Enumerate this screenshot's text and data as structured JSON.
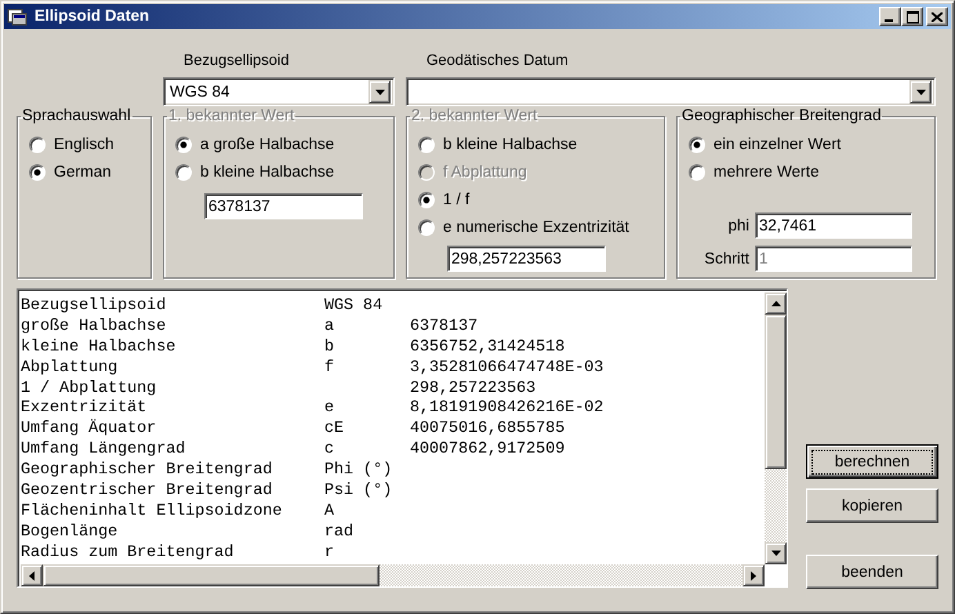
{
  "window": {
    "title": "Ellipsoid Daten"
  },
  "selectors": [
    {
      "label": "Bezugsellipsoid",
      "value": "WGS 84"
    },
    {
      "label": "Geodätisches Datum"
    }
  ],
  "groups": [
    {
      "title": "Sprachauswahl",
      "disabled": false,
      "options": [
        {
          "label": "Englisch",
          "selected": false,
          "disabled": false
        },
        {
          "label": "German",
          "selected": true,
          "disabled": false
        }
      ]
    },
    {
      "title": "1. bekannter Wert",
      "disabled": true,
      "options": [
        {
          "label": "a große Halbachse",
          "selected": true,
          "disabled": false
        },
        {
          "label": "b kleine Halbachse",
          "selected": false,
          "disabled": false
        }
      ],
      "fields": [
        {
          "value": "6378137",
          "disabled": false
        }
      ]
    },
    {
      "title": "2. bekannter Wert",
      "disabled": true,
      "options": [
        {
          "label": "b kleine Halbachse",
          "selected": false,
          "disabled": false
        },
        {
          "label": "f Abplattung",
          "selected": false,
          "disabled": true
        },
        {
          "label": "1 / f",
          "selected": true,
          "disabled": false
        },
        {
          "label": "e numerische Exzentrizität",
          "selected": false,
          "disabled": false
        }
      ],
      "fields": [
        {
          "value": "298,257223563",
          "disabled": false
        }
      ]
    },
    {
      "title": "Geographischer Breitengrad",
      "disabled": false,
      "options": [
        {
          "label": "ein einzelner Wert",
          "selected": true,
          "disabled": false
        },
        {
          "label": "mehrere Werte",
          "selected": false,
          "disabled": false
        }
      ],
      "fields": [
        {
          "label": "phi",
          "value": "32,7461",
          "disabled": false
        },
        {
          "label": "Schritt",
          "value": "1",
          "disabled": true
        }
      ]
    }
  ],
  "output": {
    "rows": [
      {
        "label": "Bezugsellipsoid",
        "symbol": "WGS 84"
      },
      {
        "label": "große Halbachse",
        "symbol": "a",
        "value": "6378137"
      },
      {
        "label": "kleine Halbachse",
        "symbol": "b",
        "value": "6356752,31424518"
      },
      {
        "label": "Abplattung",
        "symbol": "f",
        "value": "3,35281066474748E-03"
      },
      {
        "label": "1 / Abplattung",
        "value": "298,257223563"
      },
      {
        "label": "Exzentrizität",
        "symbol": "e",
        "value": "8,18191908426216E-02"
      },
      {
        "label": "Umfang Äquator",
        "symbol": "cE",
        "value": "40075016,6855785"
      },
      {
        "label": "Umfang Längengrad",
        "symbol": "c",
        "value": "40007862,9172509"
      },
      {
        "label": "Geographischer Breitengrad",
        "symbol": "Phi (°)"
      },
      {
        "label": "Geozentrischer Breitengrad",
        "symbol": "Psi (°)"
      },
      {
        "label": "Flächeninhalt Ellipsoidzone",
        "symbol": "A"
      },
      {
        "label": "Bogenlänge",
        "symbol": "rad"
      },
      {
        "label": "Radius zum Breitengrad",
        "symbol": "r"
      }
    ]
  },
  "buttons": [
    {
      "label": "berechnen",
      "default": true
    },
    {
      "label": "kopieren",
      "default": false
    },
    {
      "label": "beenden",
      "default": false
    }
  ]
}
